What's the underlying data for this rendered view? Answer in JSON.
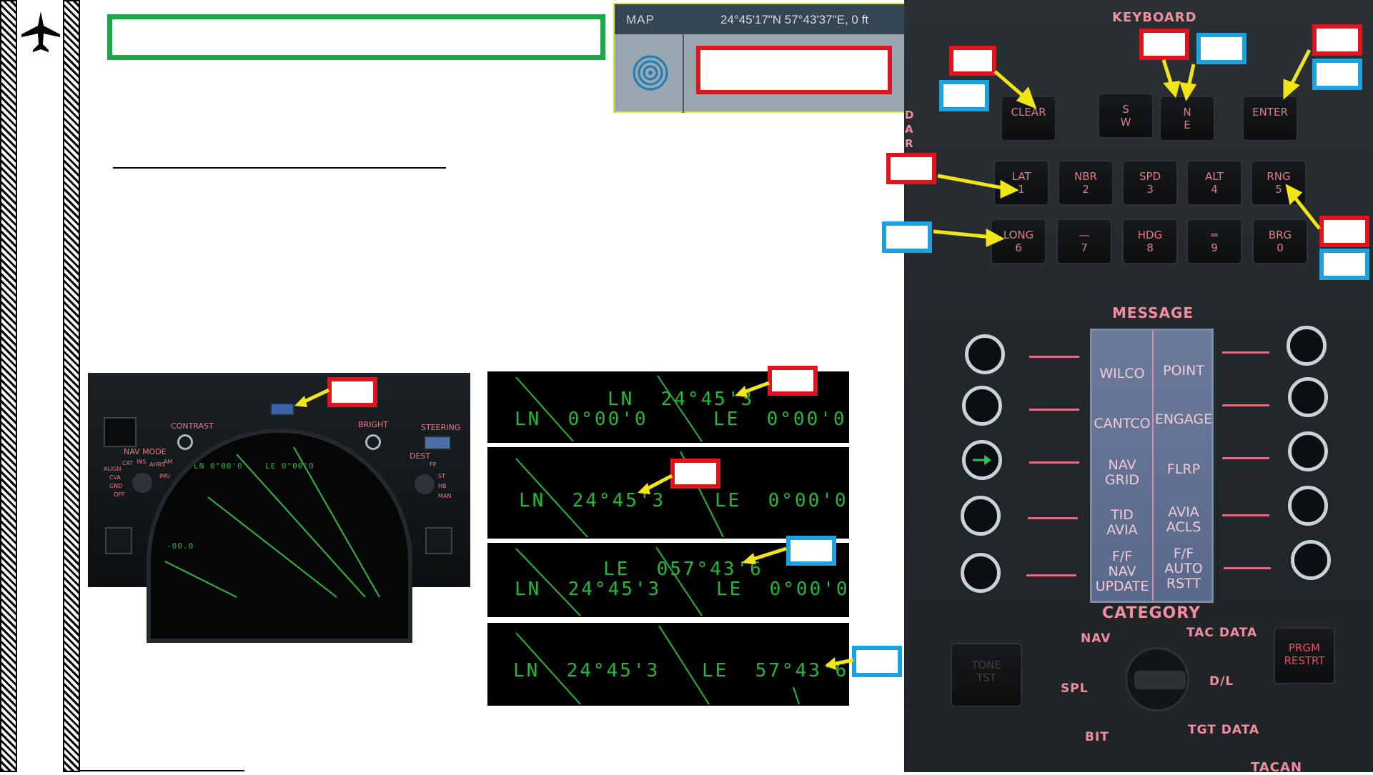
{
  "map": {
    "title": "MAP",
    "coordinates": "24°45'17\"N 57°43'37\"E, 0 ft"
  },
  "display_panel": {
    "contrast": "CONTRAST",
    "bright": "BRIGHT",
    "steering": "STEERING",
    "nav_mode": "NAV MODE",
    "nav_mode_positions": [
      "ALIGN",
      "CVA",
      "GND",
      "OFF",
      "CAT",
      "INS",
      "AHRS",
      "AM",
      "IMU"
    ],
    "dest": "DEST",
    "dest_positions": [
      "FP",
      "ST",
      "HB",
      "MAN"
    ],
    "screen_ln": "LN 0°00'0",
    "screen_le": "LE 0°00'0",
    "screen_bottom": "-00.0"
  },
  "tid_readouts": [
    {
      "line1": "LN  24°45'3",
      "line2_left": "LN  0°00'0",
      "line2_right": "LE  0°00'0"
    },
    {
      "line2_left": "LN  24°45'3",
      "line2_right": "LE  0°00'0"
    },
    {
      "line1": "LE  057°43'6",
      "line2_left": "LN  24°45'3",
      "line2_right": "LE  0°00'0"
    },
    {
      "line2_left": "LN  24°45'3",
      "line2_right": "LE  57°43'6"
    }
  ],
  "keyboard": {
    "title": "KEYBOARD",
    "keys_row1": [
      {
        "label": "CLEAR"
      },
      {
        "label": "S\nW"
      },
      {
        "label": "N\nE"
      },
      {
        "label": "ENTER"
      }
    ],
    "keys_row2": [
      {
        "label": "LAT\n1"
      },
      {
        "label": "NBR\n2"
      },
      {
        "label": "SPD\n3"
      },
      {
        "label": "ALT\n4"
      },
      {
        "label": "RNG\n5"
      }
    ],
    "keys_row3": [
      {
        "label": "LONG\n6"
      },
      {
        "label": "—\n7"
      },
      {
        "label": "HDG\n8"
      },
      {
        "label": "═\n9"
      },
      {
        "label": "BRG\n0"
      }
    ]
  },
  "message": {
    "title": "MESSAGE",
    "left": [
      "WILCO",
      "CANTCO",
      "NAV\nGRID",
      "TID\nAVIA",
      "F/F\nNAV\nUPDATE"
    ],
    "right": [
      "POINT",
      "ENGAGE",
      "FLRP",
      "AVIA\nACLS",
      "F/F\nAUTO\nRSTT"
    ]
  },
  "category": {
    "title": "CATEGORY",
    "positions": [
      "NAV",
      "TAC DATA",
      "SPL",
      "D/L",
      "BIT",
      "TGT DATA"
    ],
    "tone": "TONE\nTST",
    "prgm": "PRGM\nRESTRT"
  },
  "side_letters": [
    "D",
    "A",
    "R"
  ],
  "bottom_text": "TACAN",
  "colors": {
    "highlight_red": "#e0141c",
    "highlight_blue": "#1aa3e0",
    "title_box_green": "#1fa64a",
    "arrow_yellow": "#f2e516",
    "lcd_green": "#22b83a"
  }
}
